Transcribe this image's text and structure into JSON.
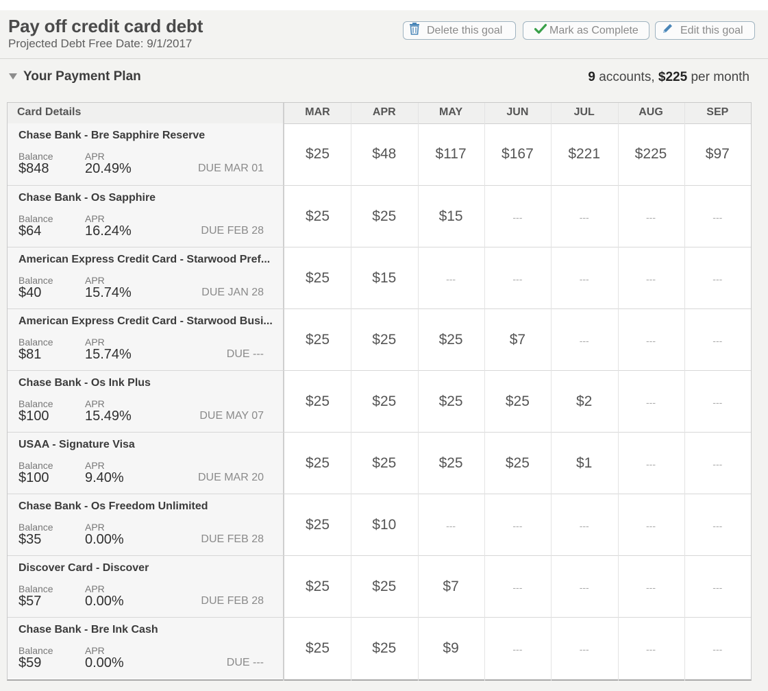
{
  "goal": {
    "title": "Pay off credit card debt",
    "subtitle": "Projected Debt Free Date: 9/1/2017",
    "actions": {
      "delete": "Delete this goal",
      "complete": "Mark as Complete",
      "edit": "Edit this goal"
    }
  },
  "plan": {
    "title": "Your Payment Plan",
    "accounts_count": "9",
    "accounts_word": "accounts,",
    "monthly_amount": "$225",
    "monthly_word": "per month"
  },
  "table": {
    "card_header": "Card Details",
    "balance_label": "Balance",
    "apr_label": "APR",
    "months": [
      "MAR",
      "APR",
      "MAY",
      "JUN",
      "JUL",
      "AUG",
      "SEP"
    ],
    "rows": [
      {
        "name": "Chase Bank - Bre Sapphire Reserve",
        "balance": "$848",
        "apr": "20.49%",
        "due": "DUE MAR 01",
        "payments": [
          "$25",
          "$48",
          "$117",
          "$167",
          "$221",
          "$225",
          "$97"
        ]
      },
      {
        "name": "Chase Bank - Os Sapphire",
        "balance": "$64",
        "apr": "16.24%",
        "due": "DUE FEB 28",
        "payments": [
          "$25",
          "$25",
          "$15",
          "---",
          "---",
          "---",
          "---"
        ]
      },
      {
        "name": "American Express Credit Card - Starwood Pref...",
        "balance": "$40",
        "apr": "15.74%",
        "due": "DUE JAN 28",
        "payments": [
          "$25",
          "$15",
          "---",
          "---",
          "---",
          "---",
          "---"
        ]
      },
      {
        "name": "American Express Credit Card - Starwood Busi...",
        "balance": "$81",
        "apr": "15.74%",
        "due": "DUE ---",
        "payments": [
          "$25",
          "$25",
          "$25",
          "$7",
          "---",
          "---",
          "---"
        ]
      },
      {
        "name": "Chase Bank - Os Ink Plus",
        "balance": "$100",
        "apr": "15.49%",
        "due": "DUE MAY 07",
        "payments": [
          "$25",
          "$25",
          "$25",
          "$25",
          "$2",
          "---",
          "---"
        ]
      },
      {
        "name": "USAA - Signature Visa",
        "balance": "$100",
        "apr": "9.40%",
        "due": "DUE MAR 20",
        "payments": [
          "$25",
          "$25",
          "$25",
          "$25",
          "$1",
          "---",
          "---"
        ]
      },
      {
        "name": "Chase Bank - Os Freedom Unlimited",
        "balance": "$35",
        "apr": "0.00%",
        "due": "DUE FEB 28",
        "payments": [
          "$25",
          "$10",
          "---",
          "---",
          "---",
          "---",
          "---"
        ]
      },
      {
        "name": "Discover Card - Discover",
        "balance": "$57",
        "apr": "0.00%",
        "due": "DUE FEB 28",
        "payments": [
          "$25",
          "$25",
          "$7",
          "---",
          "---",
          "---",
          "---"
        ]
      },
      {
        "name": "Chase Bank - Bre Ink Cash",
        "balance": "$59",
        "apr": "0.00%",
        "due": "DUE ---",
        "payments": [
          "$25",
          "$25",
          "$9",
          "---",
          "---",
          "---",
          "---"
        ]
      }
    ]
  },
  "icons": {
    "delete": "trash-icon",
    "complete": "checkmark-icon",
    "edit": "pencil-icon",
    "toggle": "triangle-down-icon"
  },
  "colors": {
    "checkmark": "#3aa04a",
    "trash": "#4a86b8",
    "pencil": "#4a86b8"
  }
}
